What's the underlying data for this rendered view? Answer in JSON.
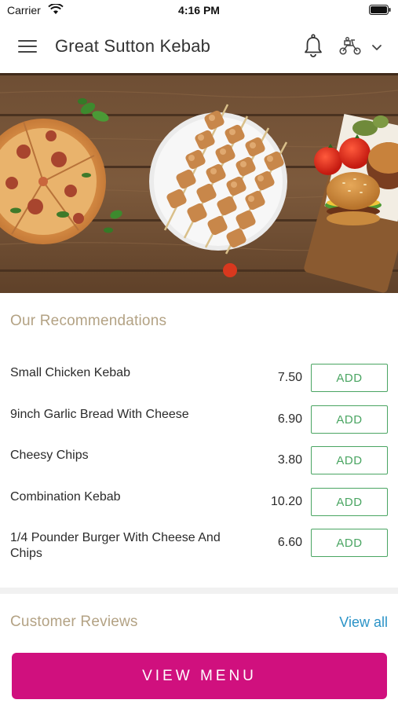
{
  "status_bar": {
    "carrier": "Carrier",
    "time": "4:16 PM"
  },
  "header": {
    "title": "Great Sutton Kebab",
    "icons": [
      "hamburger-menu-icon",
      "bell-icon",
      "scooter-delivery-icon",
      "chevron-down-icon"
    ]
  },
  "recommendations": {
    "title": "Our Recommendations",
    "add_label": "ADD",
    "items": [
      {
        "name": "Small Chicken Kebab",
        "price": "7.50"
      },
      {
        "name": "9inch Garlic Bread With Cheese",
        "price": "6.90"
      },
      {
        "name": "Cheesy Chips",
        "price": "3.80"
      },
      {
        "name": "Combination Kebab",
        "price": "10.20"
      },
      {
        "name": "1/4 Pounder Burger With Cheese And Chips",
        "price": "6.60"
      }
    ]
  },
  "reviews": {
    "title": "Customer Reviews",
    "view_all": "View all"
  },
  "footer": {
    "view_menu": "VIEW MENU"
  },
  "colors": {
    "accent": "#d0107e",
    "add_green": "#4aa562",
    "section_title": "#b3a284",
    "link_blue": "#2b93c7"
  }
}
